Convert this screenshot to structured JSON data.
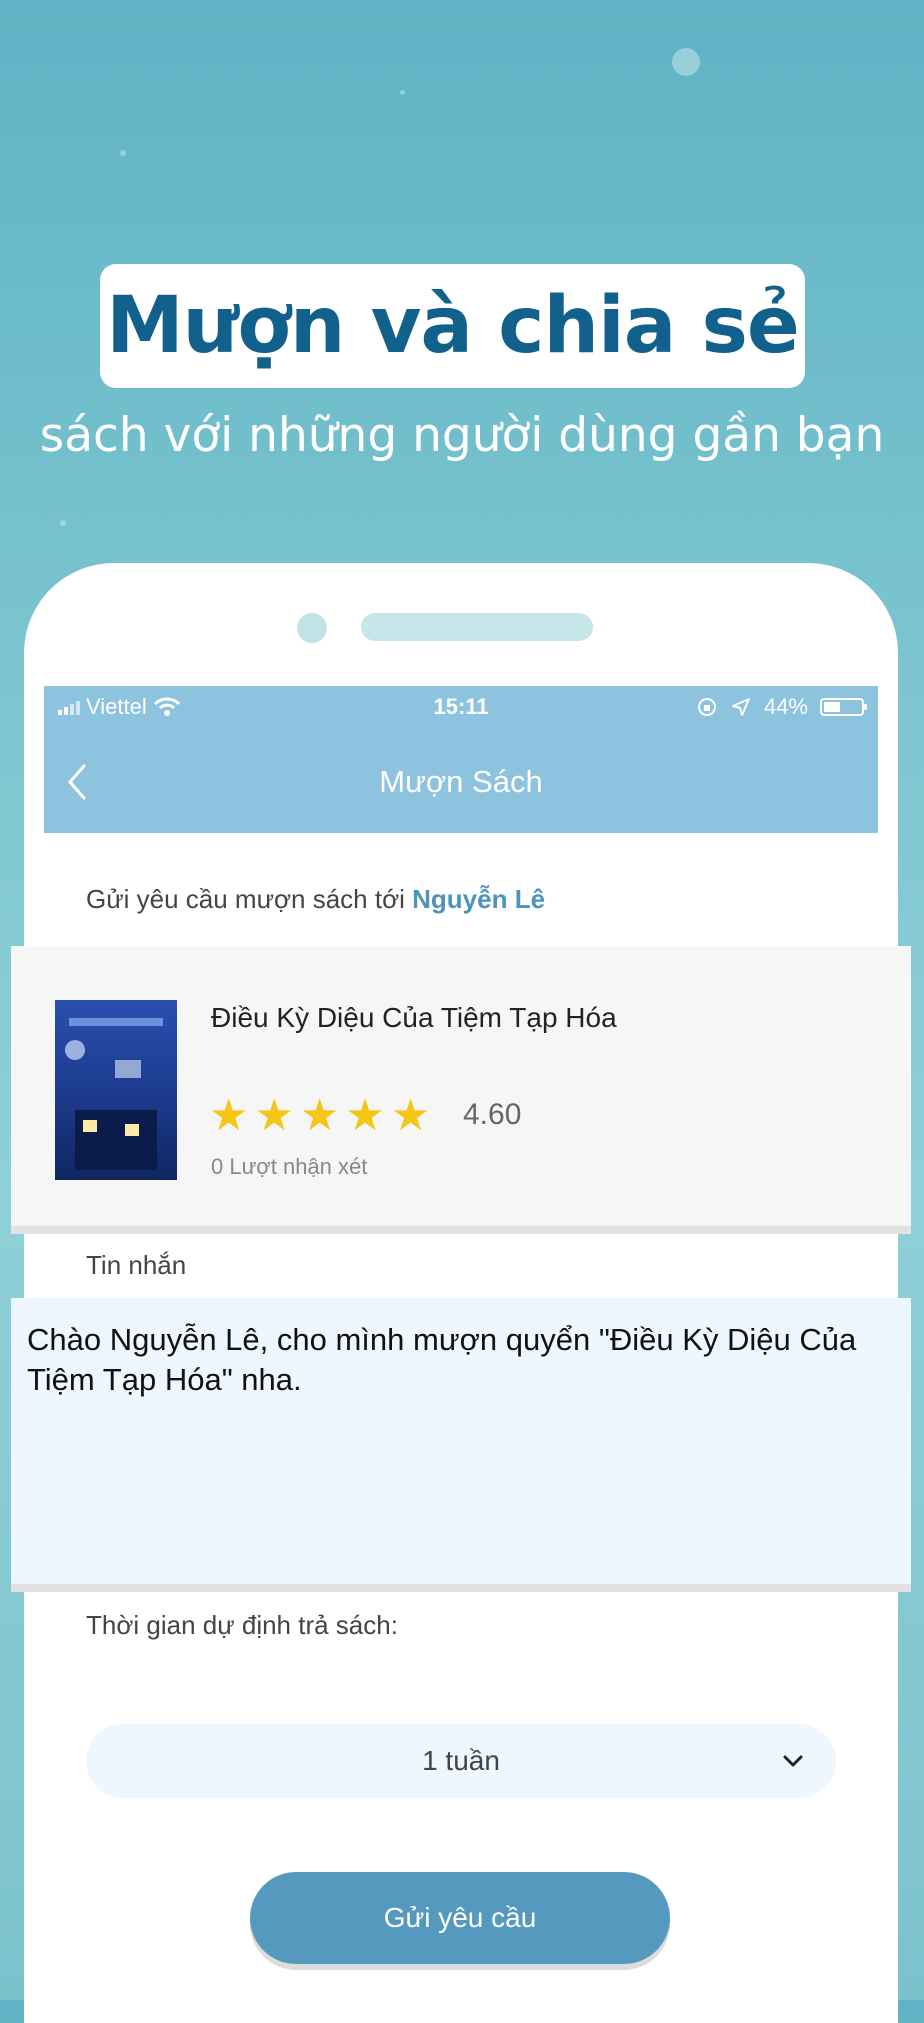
{
  "headline": {
    "title": "Mượn và chia sẻ",
    "subtitle": "sách với những người dùng gần bạn"
  },
  "status_bar": {
    "carrier": "Viettel",
    "time": "15:11",
    "battery": "44%",
    "battery_level": 0.44
  },
  "nav": {
    "title": "Mượn Sách",
    "back_icon": "chevron-left-icon"
  },
  "request": {
    "prefix": "Gửi yêu cầu mượn sách tới",
    "recipient": "Nguyễn Lê"
  },
  "book": {
    "title": "Điều Kỳ Diệu Của Tiệm Tạp Hóa",
    "rating": "4.60",
    "stars": 5,
    "reviews": "0 Lượt nhận xét"
  },
  "message": {
    "label": "Tin nhắn",
    "text": "Chào Nguyễn Lê, cho mình mượn quyển \"Điều Kỳ Diệu Của Tiệm Tạp Hóa\" nha."
  },
  "return_time": {
    "label": "Thời gian dự định trả sách:",
    "selected": "1 tuần"
  },
  "submit": {
    "label": "Gửi yêu cầu"
  },
  "colors": {
    "title_blue": "#12618c",
    "header_blue": "#8ec3e0",
    "accent_blue": "#4e93bc",
    "button_blue": "#5699bf",
    "star_yellow": "#f5c518"
  }
}
